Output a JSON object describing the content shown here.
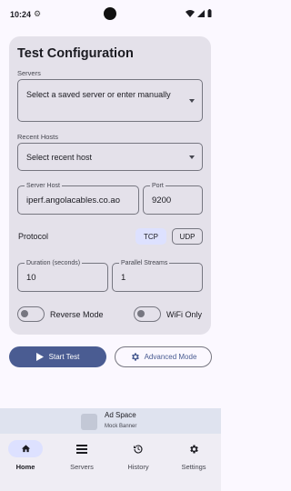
{
  "status_bar": {
    "time": "10:24",
    "gear_glyph": "⚙"
  },
  "title": "Test Configuration",
  "servers": {
    "label": "Servers",
    "placeholder": "Select a saved server or enter manually"
  },
  "recent_hosts": {
    "label": "Recent Hosts",
    "placeholder": "Select recent host"
  },
  "server_host": {
    "label": "Server Host",
    "value": "iperf.angolacables.co.ao"
  },
  "port": {
    "label": "Port",
    "value": "9200"
  },
  "protocol": {
    "label": "Protocol",
    "options": [
      "TCP",
      "UDP"
    ],
    "selected": "TCP"
  },
  "duration": {
    "label": "Duration (seconds)",
    "value": "10"
  },
  "parallel_streams": {
    "label": "Parallel Streams",
    "value": "1"
  },
  "reverse_mode": {
    "label": "Reverse Mode",
    "on": false
  },
  "wifi_only": {
    "label": "WiFi Only",
    "on": false
  },
  "buttons": {
    "start": "Start Test",
    "advanced": "Advanced Mode"
  },
  "ad": {
    "title": "Ad Space",
    "subtitle": "Mock Banner"
  },
  "nav": [
    {
      "label": "Home",
      "icon": "home-icon",
      "active": true
    },
    {
      "label": "Servers",
      "icon": "list-icon",
      "active": false
    },
    {
      "label": "History",
      "icon": "history-icon",
      "active": false
    },
    {
      "label": "Settings",
      "icon": "gear-icon",
      "active": false
    }
  ],
  "colors": {
    "primary": "#4a5c92",
    "card": "#e4e1ea",
    "background": "#fbf8ff",
    "selected_chip": "#dde1ff"
  }
}
